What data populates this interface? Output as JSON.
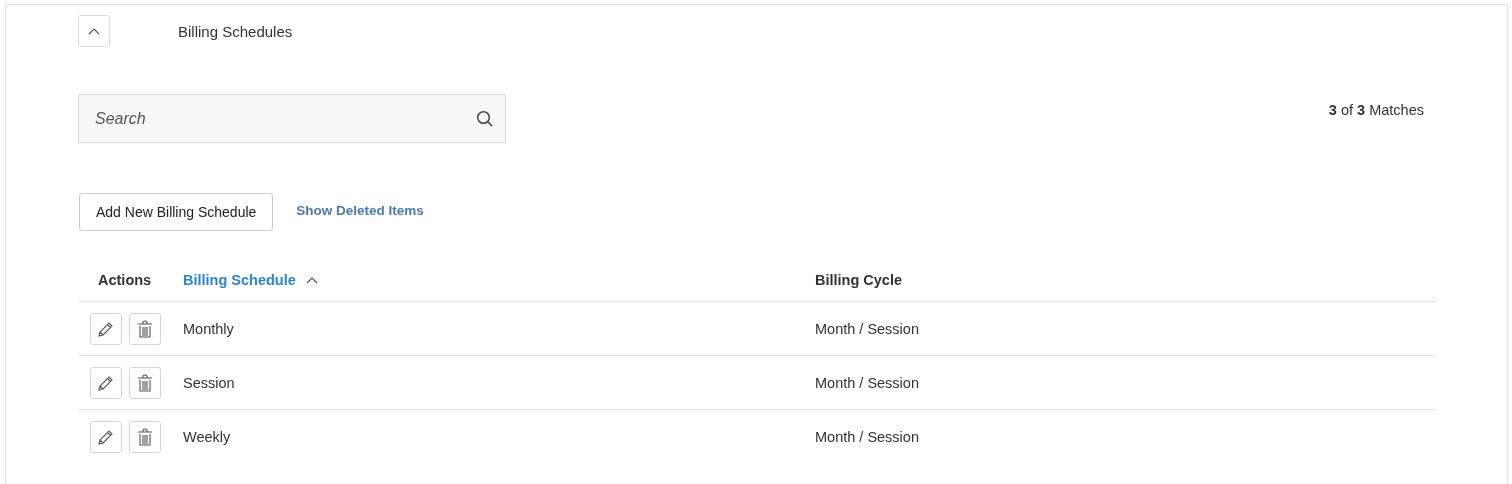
{
  "section": {
    "title": "Billing Schedules",
    "expanded": true
  },
  "search": {
    "placeholder": "Search"
  },
  "matches": "**3** of **3** Matches",
  "add_button": "Add New Billing Schedule",
  "show_deleted_link": "Show Deleted Items",
  "table": {
    "columns": [
      {
        "label": "Actions",
        "sorted": false
      },
      {
        "label": "Billing Schedule",
        "sorted": true
      },
      {
        "label": "Billing Cycle",
        "sorted": false
      }
    ],
    "rows": [
      {
        "billing_schedule": "Monthly",
        "billing_cycle": "Month / Session"
      },
      {
        "billing_schedule": "Session",
        "billing_cycle": "Month / Session"
      },
      {
        "billing_schedule": "Weekly",
        "billing_cycle": "Month / Session"
      }
    ]
  }
}
